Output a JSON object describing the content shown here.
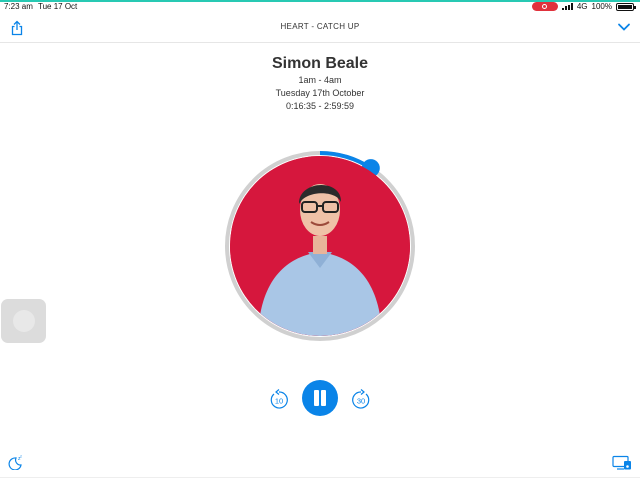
{
  "status_bar": {
    "time": "7:23 am",
    "date": "Tue 17 Oct",
    "network": "4G",
    "battery": "100%",
    "battery_level": 1.0
  },
  "header": {
    "title": "HEART - CATCH UP",
    "share_icon": "share-icon",
    "collapse_icon": "chevron-down-icon"
  },
  "show": {
    "host": "Simon Beale",
    "time_slot": "1am - 4am",
    "date": "Tuesday 17th October",
    "playback_range": "0:16:35 - 2:59:59"
  },
  "playback": {
    "progress_fraction": 0.092,
    "rewind_label": "10",
    "forward_label": "30",
    "state": "playing"
  },
  "colors": {
    "accent": "#0a84e8",
    "artwork_bg": "#d6173d",
    "ring_track": "#d0d0d0",
    "top_line": "#28c9b3"
  }
}
